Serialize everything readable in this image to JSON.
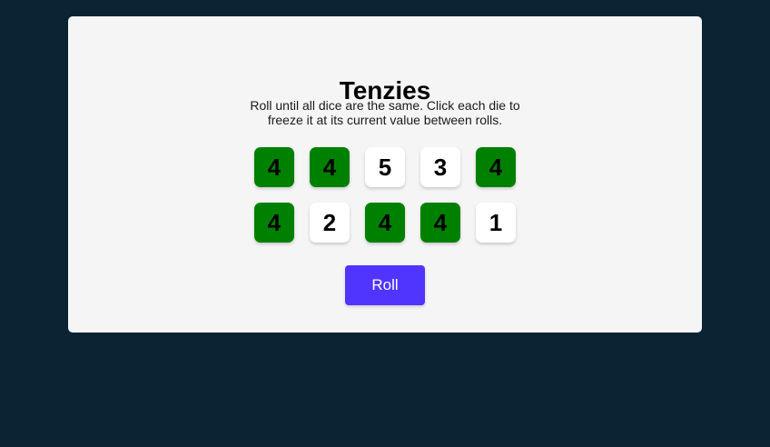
{
  "game": {
    "title": "Tenzies",
    "instructions_line1": "Roll until all dice are the same. Click each die to",
    "instructions_line2": "freeze it at its current value between rolls.",
    "roll_label": "Roll"
  },
  "dice": [
    {
      "value": "4",
      "held": true
    },
    {
      "value": "4",
      "held": true
    },
    {
      "value": "5",
      "held": false
    },
    {
      "value": "3",
      "held": false
    },
    {
      "value": "4",
      "held": true
    },
    {
      "value": "4",
      "held": true
    },
    {
      "value": "2",
      "held": false
    },
    {
      "value": "4",
      "held": true
    },
    {
      "value": "4",
      "held": true
    },
    {
      "value": "1",
      "held": false
    }
  ],
  "colors": {
    "background": "#0b2434",
    "card": "#f5f5f5",
    "held_die": "#008000",
    "die": "#ffffff",
    "button": "#5035ff"
  }
}
